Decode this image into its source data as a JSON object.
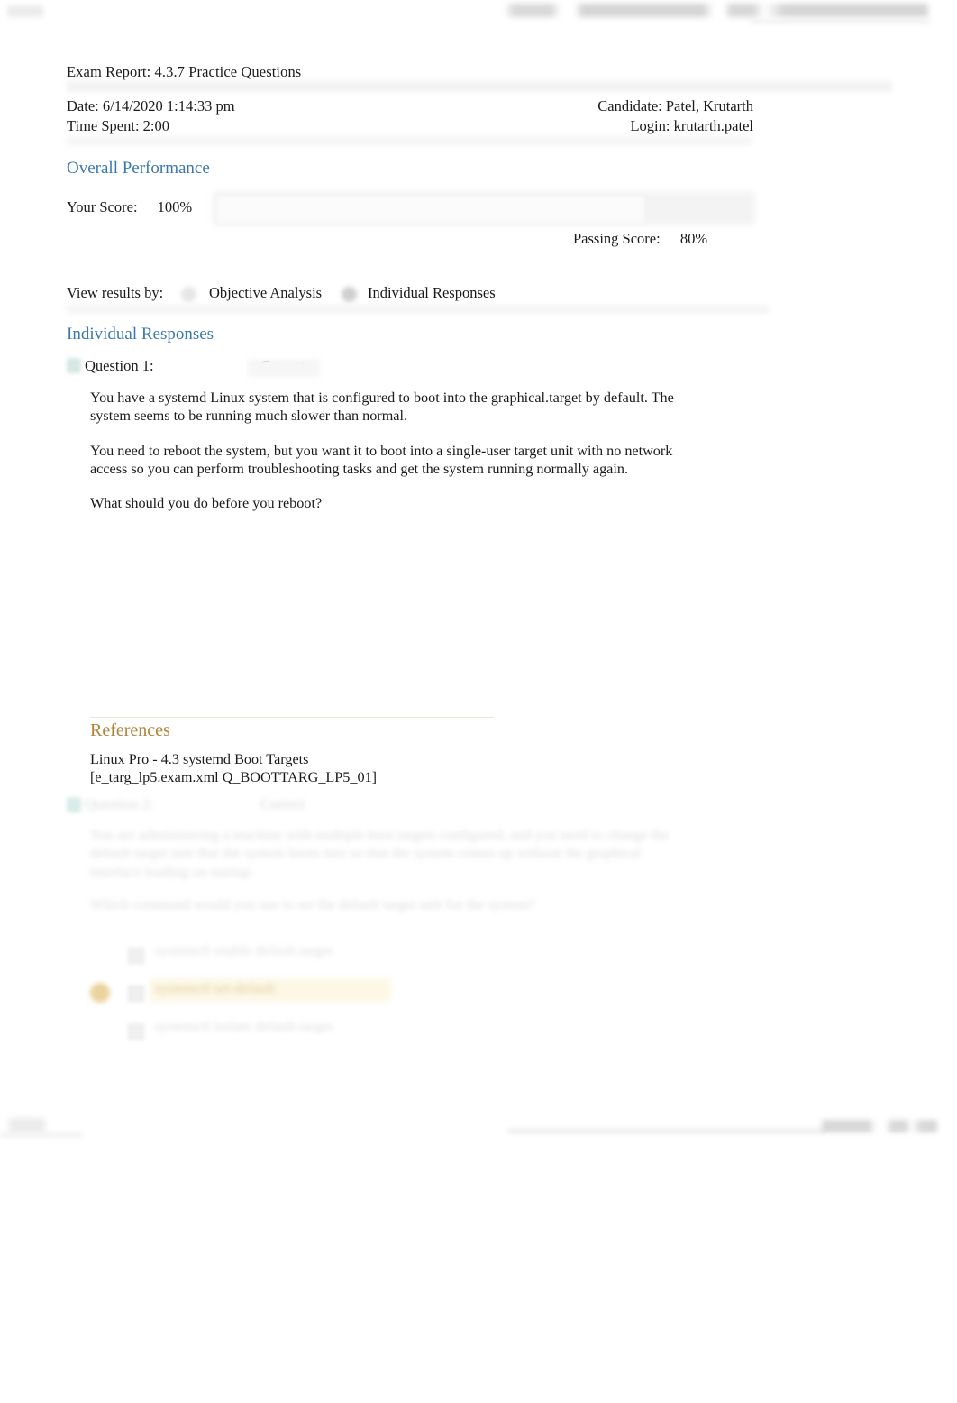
{
  "browser_chrome": {
    "left_control": "",
    "tab_strip": "",
    "address_bar": ""
  },
  "report": {
    "title": "Exam Report: 4.3.7 Practice Questions",
    "date_label": "Date: 6/14/2020 1:14:33 pm",
    "time_spent_label": "Time Spent: 2:00",
    "candidate_label": "Candidate: Patel, Krutarth",
    "login_label": "Login: krutarth.patel"
  },
  "overall_performance": {
    "heading": "Overall Performance",
    "your_score_label": "Your Score:",
    "your_score_value": "100%",
    "passing_score_label": "Passing Score:",
    "passing_score_value": "80%",
    "score_percent": 100,
    "passing_percent": 80
  },
  "view_results_by": {
    "label": "View results by:",
    "options": [
      {
        "label": "Objective Analysis",
        "selected": false
      },
      {
        "label": "Individual Responses",
        "selected": true
      }
    ]
  },
  "individual_responses": {
    "heading": "Individual Responses",
    "questions": [
      {
        "label": "Question 1:",
        "status": "Correct",
        "paragraphs": [
          "You have a systemd Linux system that is configured to boot into the graphical.target by default. The system seems to be running much slower than normal.",
          "You need to reboot the system, but you want it to boot into a single-user target unit with no network access so you can perform troubleshooting tasks and get the system running normally again.",
          "What should you do before you reboot?"
        ],
        "references": {
          "heading": "References",
          "lines": [
            "Linux Pro - 4.3 systemd Boot Targets",
            "[e_targ_lp5.exam.xml Q_BOOTTARG_LP5_01]"
          ]
        }
      },
      {
        "label": "",
        "status": "",
        "paragraphs": [
          "",
          ""
        ],
        "answers": [
          {
            "text": "",
            "correct": false
          },
          {
            "text": "",
            "correct": true
          },
          {
            "text": "",
            "correct": false
          }
        ]
      }
    ]
  },
  "footer": {
    "left": "",
    "center": "",
    "right": ""
  },
  "colors": {
    "section_heading_blue": "#3b78b0",
    "references_gold": "#b1843a",
    "correct_highlight": "#e8cf92",
    "page_background": "#ffffff",
    "body_text": "#1a1a1a"
  }
}
